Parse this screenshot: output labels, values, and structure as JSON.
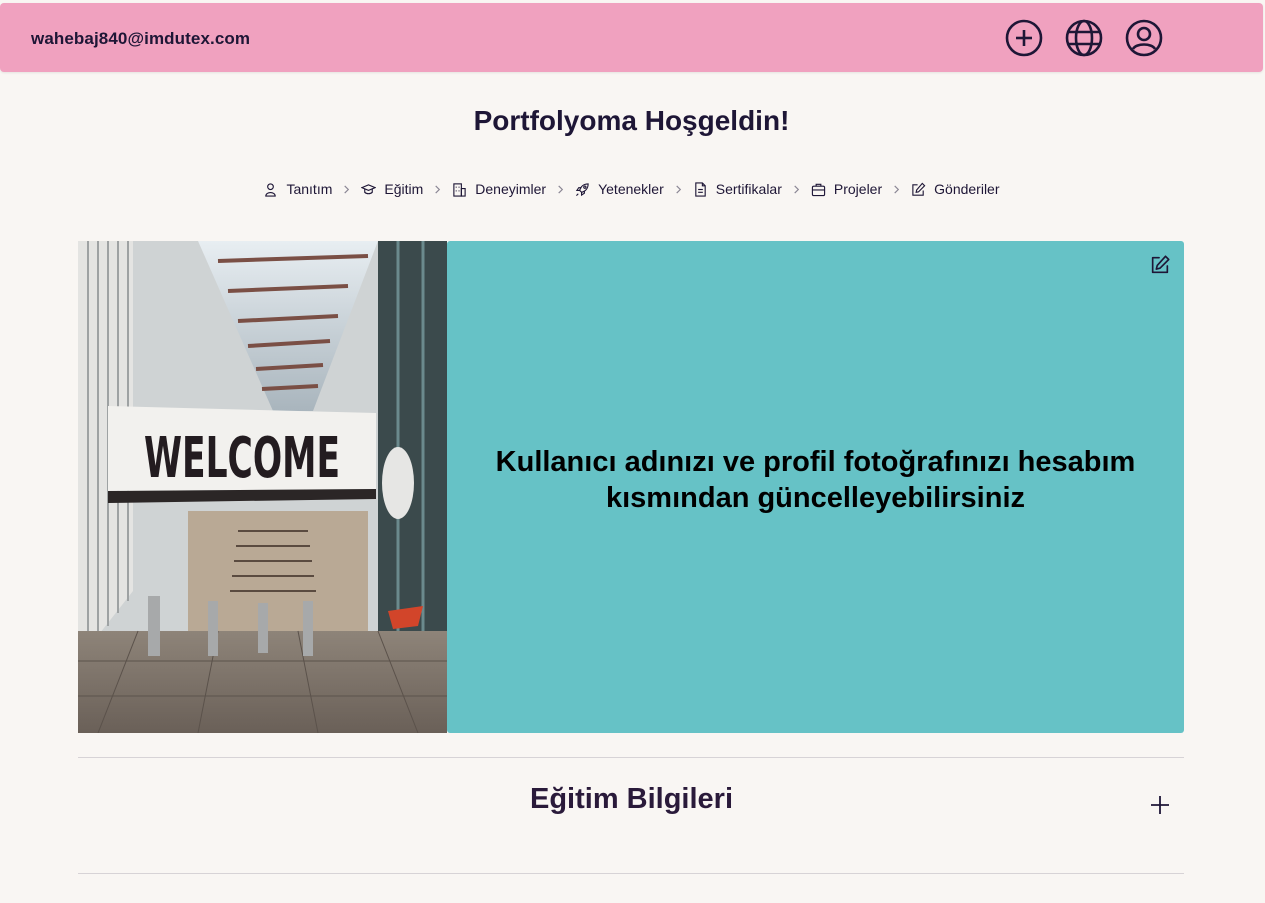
{
  "header": {
    "email": "wahebaj840@imdutex.com",
    "icons": [
      "add-circle-icon",
      "globe-icon",
      "user-circle-icon"
    ],
    "bg_color": "#f0a1bf"
  },
  "page": {
    "title": "Portfolyoma Hoşgeldin!"
  },
  "breadcrumb": {
    "items": [
      {
        "label": "Tanıtım",
        "icon": "user-icon"
      },
      {
        "label": "Eğitim",
        "icon": "graduation-cap-icon"
      },
      {
        "label": "Deneyimler",
        "icon": "building-icon"
      },
      {
        "label": "Yetenekler",
        "icon": "rocket-icon"
      },
      {
        "label": "Sertifikalar",
        "icon": "document-icon"
      },
      {
        "label": "Projeler",
        "icon": "briefcase-icon"
      },
      {
        "label": "Gönderiler",
        "icon": "edit-icon"
      }
    ]
  },
  "hero": {
    "photo_sign_text": "WELCOME",
    "card_message": "Kullanıcı adınızı ve profil fotoğrafınızı hesabım kısmından güncelleyebilirsiniz",
    "card_color": "#66c2c6"
  },
  "sections": {
    "education_title": "Eğitim Bilgileri"
  }
}
